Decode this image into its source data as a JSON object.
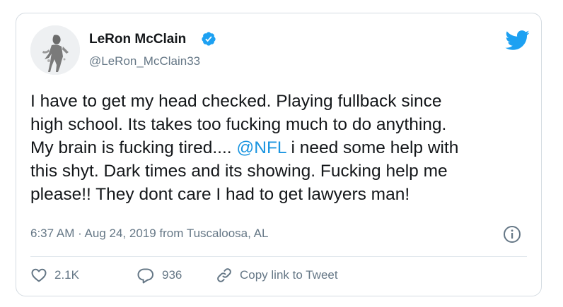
{
  "user": {
    "display_name": "LeRon McClain",
    "handle": "@LeRon_McClain33",
    "verified_icon": "verified-badge-icon",
    "avatar": "avatar"
  },
  "tweet": {
    "lines": [
      {
        "parts": [
          {
            "text": "I have to get my head checked. Playing fullback since",
            "type": "text"
          }
        ]
      },
      {
        "parts": [
          {
            "text": "high school. Its takes too fucking much to do anything.",
            "type": "text"
          }
        ]
      },
      {
        "parts": [
          {
            "text": "My brain is fucking tired.... ",
            "type": "text"
          },
          {
            "text": "@NFL",
            "type": "mention"
          },
          {
            "text": " i need some help with",
            "type": "text"
          }
        ]
      },
      {
        "parts": [
          {
            "text": "this shyt. Dark times and its showing. Fucking help me",
            "type": "text"
          }
        ]
      },
      {
        "parts": [
          {
            "text": "please!! They dont care I had to get lawyers man!",
            "type": "text"
          }
        ]
      }
    ],
    "timestamp": "6:37 AM · Aug 24, 2019 from Tuscaloosa, AL"
  },
  "actions": {
    "like_count": "2.1K",
    "reply_count": "936",
    "copy_link_label": "Copy link to Tweet"
  },
  "colors": {
    "brand_blue": "#1da1f2",
    "mention_blue": "#1b95e0",
    "secondary_text": "#657786"
  },
  "icons": [
    "twitter-bird-icon",
    "verified-badge-icon",
    "info-icon",
    "heart-icon",
    "reply-icon",
    "link-icon"
  ]
}
